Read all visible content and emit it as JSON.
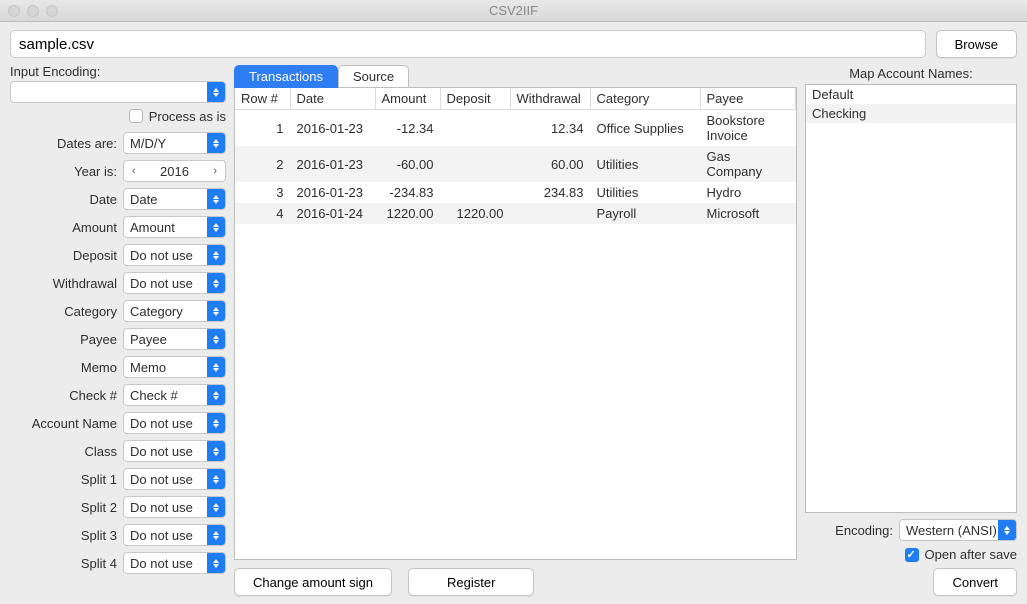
{
  "window": {
    "title": "CSV2IIF"
  },
  "file": {
    "path": "sample.csv",
    "browse": "Browse"
  },
  "left": {
    "input_encoding_label": "Input Encoding:",
    "input_encoding_value": "",
    "process_as_is": "Process as is",
    "rows": {
      "dates_are": {
        "label": "Dates are:",
        "value": "M/D/Y"
      },
      "year_is": {
        "label": "Year is:",
        "value": "2016"
      },
      "date": {
        "label": "Date",
        "value": "Date"
      },
      "amount": {
        "label": "Amount",
        "value": "Amount"
      },
      "deposit": {
        "label": "Deposit",
        "value": "Do not use"
      },
      "withdrawal": {
        "label": "Withdrawal",
        "value": "Do not use"
      },
      "category": {
        "label": "Category",
        "value": "Category"
      },
      "payee": {
        "label": "Payee",
        "value": "Payee"
      },
      "memo": {
        "label": "Memo",
        "value": "Memo"
      },
      "checknum": {
        "label": "Check #",
        "value": "Check #"
      },
      "account": {
        "label": "Account Name",
        "value": "Do not use"
      },
      "class": {
        "label": "Class",
        "value": "Do not use"
      },
      "split1": {
        "label": "Split 1",
        "value": "Do not use"
      },
      "split2": {
        "label": "Split 2",
        "value": "Do not use"
      },
      "split3": {
        "label": "Split 3",
        "value": "Do not use"
      },
      "split4": {
        "label": "Split 4",
        "value": "Do not use"
      }
    }
  },
  "tabs": {
    "transactions": "Transactions",
    "source": "Source"
  },
  "table": {
    "headers": [
      "Row #",
      "Date",
      "Amount",
      "Deposit",
      "Withdrawal",
      "Category",
      "Payee"
    ],
    "rows": [
      {
        "n": "1",
        "date": "2016-01-23",
        "amount": "-12.34",
        "deposit": "",
        "withdrawal": "12.34",
        "category": "Office Supplies",
        "payee": "Bookstore Invoice"
      },
      {
        "n": "2",
        "date": "2016-01-23",
        "amount": "-60.00",
        "deposit": "",
        "withdrawal": "60.00",
        "category": "Utilities",
        "payee": "Gas Company"
      },
      {
        "n": "3",
        "date": "2016-01-23",
        "amount": "-234.83",
        "deposit": "",
        "withdrawal": "234.83",
        "category": "Utilities",
        "payee": "Hydro"
      },
      {
        "n": "4",
        "date": "2016-01-24",
        "amount": "1220.00",
        "deposit": "1220.00",
        "withdrawal": "",
        "category": "Payroll",
        "payee": "Microsoft"
      }
    ]
  },
  "bottom": {
    "change_sign": "Change amount sign",
    "register": "Register"
  },
  "right": {
    "title": "Map Account Names:",
    "items": [
      "Default",
      "Checking"
    ],
    "encoding_label": "Encoding:",
    "encoding_value": "Western (ANSI)",
    "open_after": "Open after save",
    "convert": "Convert"
  }
}
